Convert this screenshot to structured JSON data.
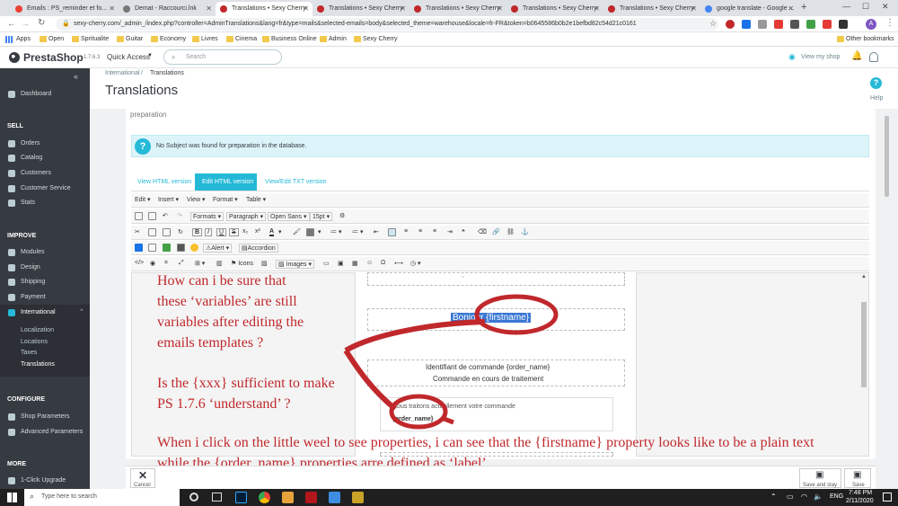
{
  "browser": {
    "tabs": [
      {
        "label": "Emails : PS_reminder et fo...",
        "fav": "#ea4335"
      },
      {
        "label": "Demat - Raccourci.lnk",
        "fav": "#777777"
      },
      {
        "label": "Translations • Sexy Cherry",
        "fav": "#c0282c",
        "active": true
      },
      {
        "label": "Translations • Sexy Cherry",
        "fav": "#c0282c"
      },
      {
        "label": "Translations • Sexy Cherry",
        "fav": "#c0282c"
      },
      {
        "label": "Translations • Sexy Cherry",
        "fav": "#c0282c"
      },
      {
        "label": "Translations • Sexy Cherry",
        "fav": "#c0282c"
      },
      {
        "label": "google translate - Google ...",
        "fav": "#4285f4"
      }
    ],
    "url": "sexy-cherry.com/_admin_/index.php?controller=AdminTranslations&lang=fr&type=mails&selected-emails=body&selected_theme=warehouse&locale=fr-FR&token=b0645586b0b2e1befbd82c54d21c0161",
    "bookmarks": [
      "Apps",
      "Open",
      "Spritualite",
      "Guitar",
      "Economy",
      "Livres",
      "Cinema",
      "Business Online",
      "Admin",
      "Sexy Cherry"
    ],
    "other_bookmarks": "Other bookmarks"
  },
  "header": {
    "logo": "PrestaShop",
    "version": "1.7.6.3",
    "quick_access": "Quick Access",
    "search_placeholder": "Search",
    "view_shop": "View my shop"
  },
  "page": {
    "breadcrumb_1": "International",
    "breadcrumb_sep": "/",
    "breadcrumb_2": "Translations",
    "title": "Translations",
    "help": "Help",
    "section_label": "preparation",
    "info_text": "No Subject was found for preparation in the database.",
    "tabs": [
      "View HTML version",
      "Edit HTML version",
      "View/Edit TXT version"
    ],
    "active_tab": 1
  },
  "sidebar": {
    "dashboard": "Dashboard",
    "sell": "SELL",
    "sell_items": [
      "Orders",
      "Catalog",
      "Customers",
      "Customer Service",
      "Stats"
    ],
    "improve": "IMPROVE",
    "improve_items": [
      "Modules",
      "Design",
      "Shipping",
      "Payment",
      "International"
    ],
    "international_sub": [
      "Localization",
      "Locations",
      "Taxes",
      "Translations"
    ],
    "configure": "CONFIGURE",
    "configure_items": [
      "Shop Parameters",
      "Advanced Parameters"
    ],
    "more": "MORE",
    "upgrade": "1-Click Upgrade"
  },
  "editor": {
    "menu": [
      "Edit",
      "Insert",
      "View",
      "Format",
      "Table"
    ],
    "formats": "Formats",
    "paragraph": "Paragraph",
    "font": "Open Sans",
    "size": "15pt",
    "alert": "Alert",
    "accordion": "Accordion",
    "icons": "Icons",
    "images": "Images"
  },
  "email": {
    "greeting": "Bonjour {firstname}",
    "order_id_line": "Identifiant de commande {order_name}",
    "status_line": "Commande en cours de traitement",
    "body_line": "Nous traitons actuellement votre commande",
    "order_var": "{order_name}"
  },
  "annotation": {
    "lines": [
      "How can i be sure that",
      "these ‘variables’ are still",
      "variables after editing the",
      "emails templates ?",
      "Is the {xxx} sufficient to make",
      "PS 1.7.6 ‘understand’ ?",
      "When i click on the little weel to see properties, i can see that the {firstname} property looks like to be a plain text",
      "while the {order_name} properties arre defined as ‘label’...."
    ],
    "color": "#c0282c"
  },
  "bottom": {
    "cancel": "Cancel",
    "save_and_stay": "Save and stay",
    "save": "Save"
  },
  "taskbar": {
    "search": "Type here to search",
    "lang": "ENG",
    "time": "7:48 PM",
    "date": "2/11/2020"
  }
}
